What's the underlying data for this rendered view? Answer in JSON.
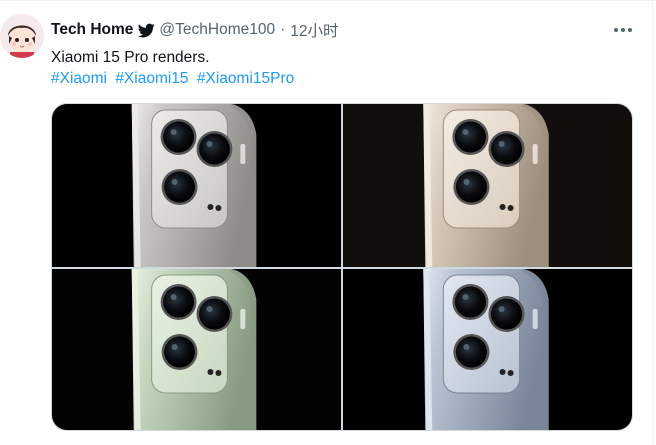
{
  "tweet": {
    "author_name": "Tech Home",
    "handle": "@TechHome100",
    "separator": "·",
    "time": "12小时",
    "text": "Xiaomi 15 Pro renders.",
    "hashtags": [
      "#Xiaomi",
      "#Xiaomi15",
      "#Xiaomi15Pro"
    ]
  },
  "icons": {
    "verified": "twitter-bird-icon",
    "more": "more-horizontal-icon"
  },
  "colors": {
    "link": "#1d9bf0",
    "secondary_text": "#536471",
    "primary_text": "#0f1419"
  },
  "media": {
    "image_count": 4,
    "variants": [
      {
        "body": "#c9c7c4",
        "light": "#ecebe8",
        "dark": "#8e8c89",
        "bg": "#000000"
      },
      {
        "body": "#d9cdbd",
        "light": "#f3ece1",
        "dark": "#9c8f7e",
        "bg": "#120e0b"
      },
      {
        "body": "#c7d7c0",
        "light": "#e9f2e3",
        "dark": "#889b82",
        "bg": "#020302"
      },
      {
        "body": "#b8c2d2",
        "light": "#e2e8f1",
        "dark": "#7a8599",
        "bg": "#000000"
      }
    ]
  }
}
